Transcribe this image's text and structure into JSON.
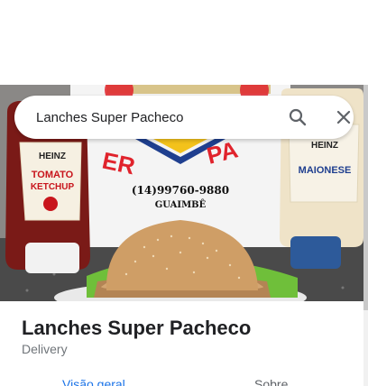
{
  "search": {
    "value": "Lanches Super Pacheco"
  },
  "hero_image": {
    "description_icons": [
      "search-icon",
      "close-icon"
    ],
    "sign_phone": "(14)99760-9880",
    "sign_city": "GUAIMBÊ",
    "ketchup_brand": "HEINZ",
    "ketchup_label_line1": "TOMATO",
    "ketchup_label_line2": "KETCHUP",
    "mayo_brand": "HEINZ",
    "mayo_label": "MAIONESE",
    "sign_letters_left": "ER",
    "sign_letters_right": "PA"
  },
  "place": {
    "title": "Lanches Super Pacheco",
    "category": "Delivery"
  },
  "tabs": {
    "overview": "Visão geral",
    "about": "Sobre"
  },
  "colors": {
    "accent": "#1a73e8",
    "title": "#202124",
    "secondary": "#70757a"
  }
}
